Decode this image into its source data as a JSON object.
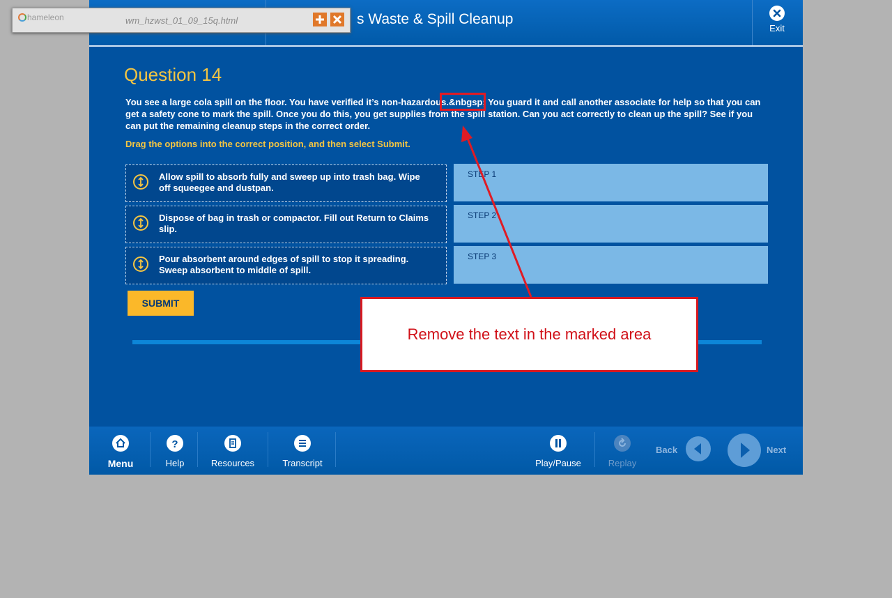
{
  "header": {
    "course_title": "s Waste & Spill Cleanup",
    "exit_label": "Exit"
  },
  "question": {
    "title": "Question 14",
    "text": "You see a large cola spill on the floor.  You have verified it’s non-hazardous.&nbgsp; You guard it and call another associate for help so that you can get a safety cone to mark the spill.  Once you do this, you get supplies from the spill station.  Can you act correctly to clean up the spill?  See if you can put the remaining cleanup steps in the correct order.",
    "instruction": "Drag the options into the correct position, and then select Submit."
  },
  "options": [
    {
      "text": "Allow spill to absorb fully and sweep up into trash bag.  Wipe off squeegee and dustpan.",
      "icon": "drag-updown-icon"
    },
    {
      "text": "Dispose of bag in trash or compactor.  Fill out Return to Claims slip.",
      "icon": "drag-updown-icon"
    },
    {
      "text": "Pour absorbent around edges of spill to stop it spreading.  Sweep absorbent to middle of spill.",
      "icon": "drag-updown-icon"
    }
  ],
  "steps": [
    {
      "label": "STEP 1"
    },
    {
      "label": "STEP 2"
    },
    {
      "label": "STEP 3"
    }
  ],
  "submit_label": "SUBMIT",
  "footer": {
    "menu": "Menu",
    "help": "Help",
    "resources": "Resources",
    "transcript": "Transcript",
    "play_pause": "Play/Pause",
    "replay": "Replay",
    "back": "Back",
    "next": "Next"
  },
  "toolbar": {
    "logo": "hameleon",
    "filename": "wm_hzwst_01_09_15q.html"
  },
  "annotation": {
    "callout": "Remove the text in the marked area"
  },
  "colors": {
    "app_bg": "#0152a0",
    "accent_yellow": "#f4c542",
    "submit_bg": "#fbb829",
    "step_bg": "#7bb8e6",
    "annotation_red": "#d81920"
  }
}
